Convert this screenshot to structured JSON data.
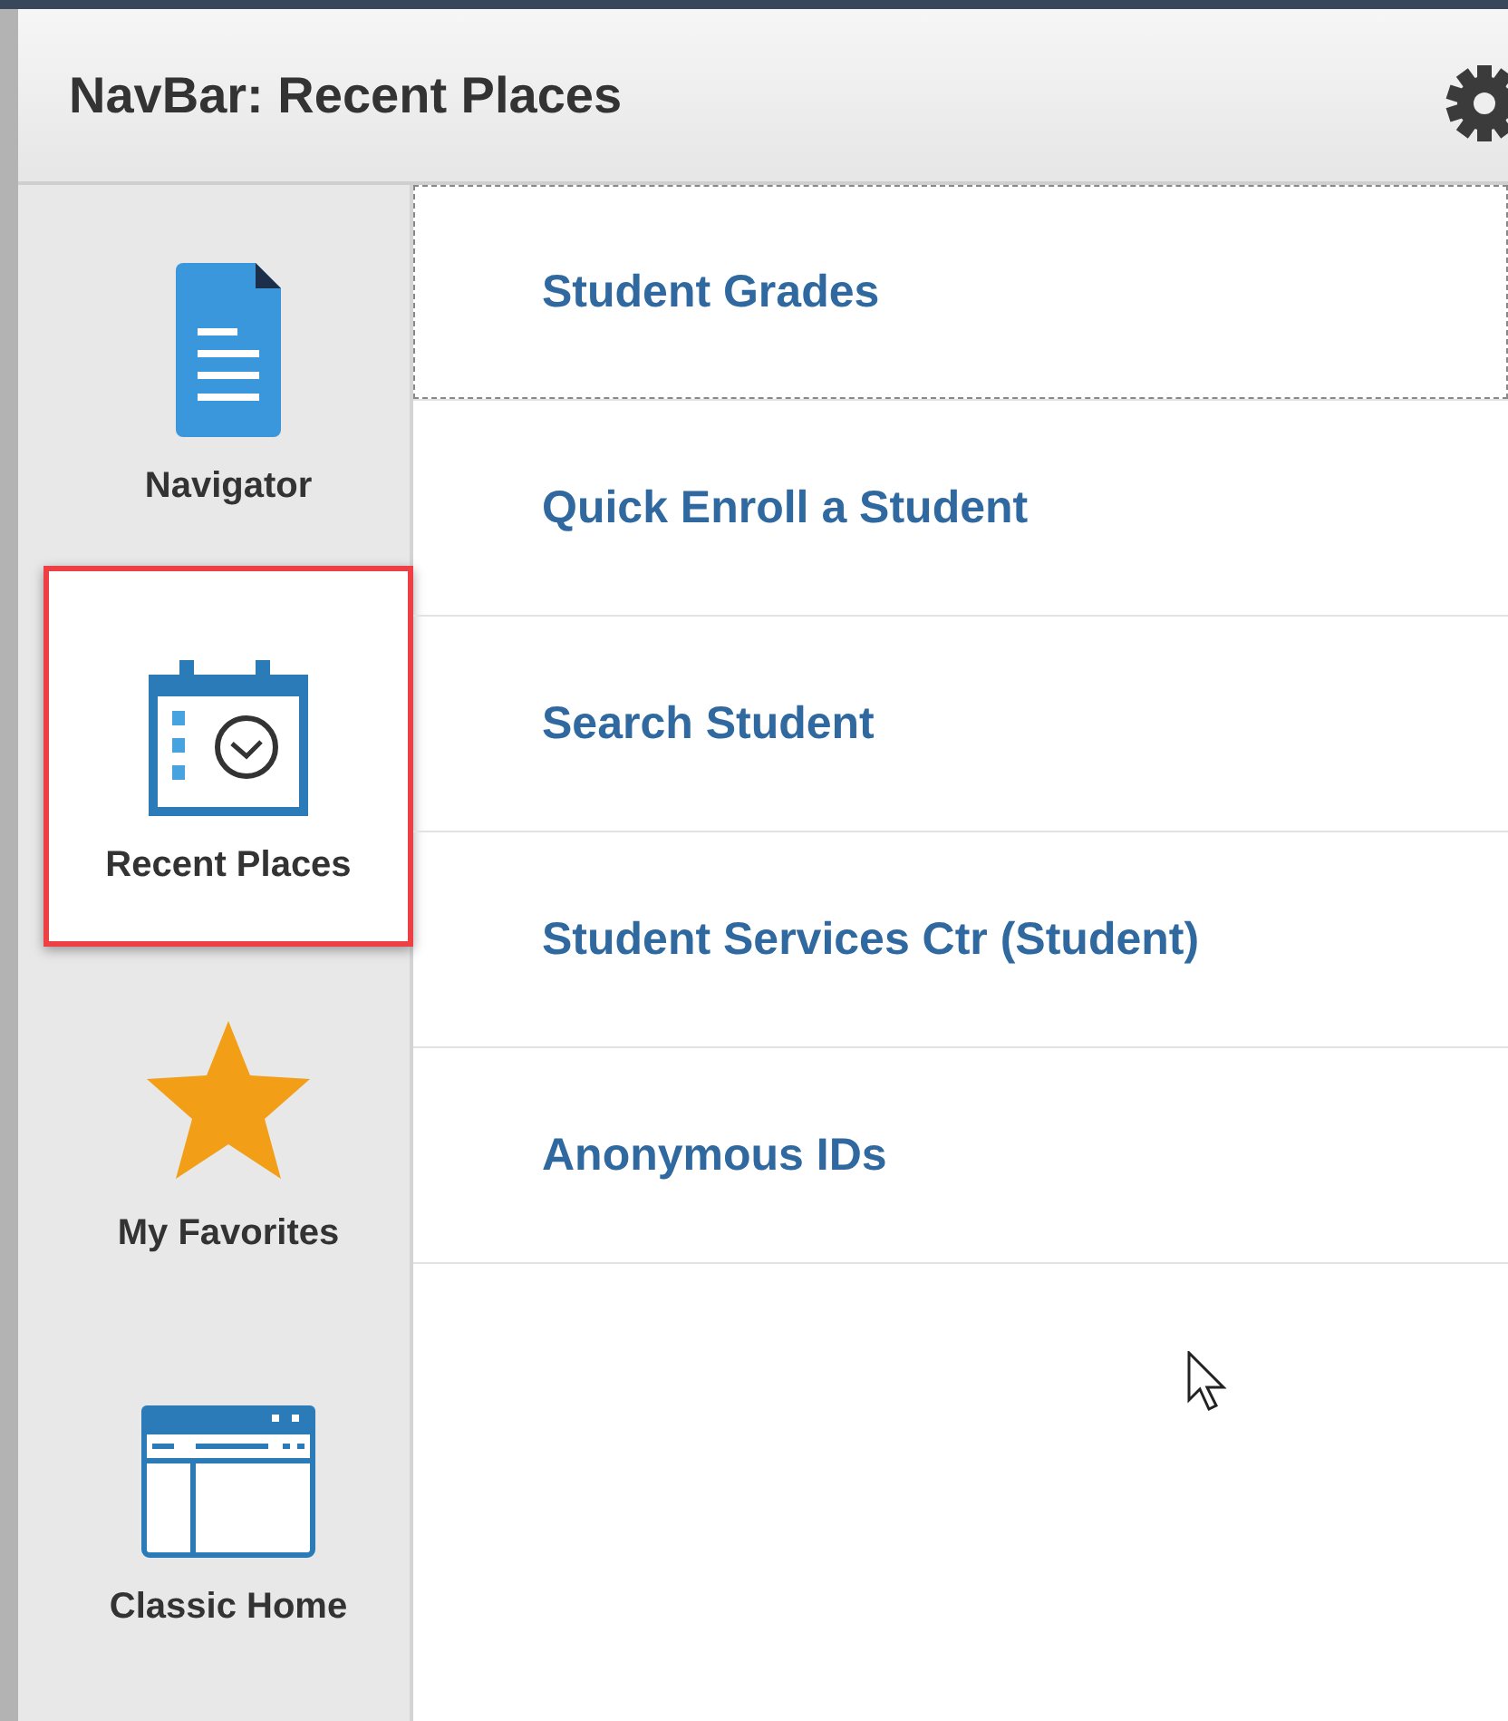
{
  "header": {
    "title": "NavBar: Recent Places"
  },
  "sidebar": {
    "items": [
      {
        "label": "Navigator",
        "kind": "document",
        "selected": false
      },
      {
        "label": "Recent Places",
        "kind": "calendar-clock",
        "selected": true
      },
      {
        "label": "My Favorites",
        "kind": "star",
        "selected": false
      },
      {
        "label": "Classic Home",
        "kind": "window",
        "selected": false
      }
    ]
  },
  "places": [
    {
      "label": "Student Grades",
      "focused": true
    },
    {
      "label": "Quick Enroll a Student",
      "focused": false
    },
    {
      "label": "Search Student",
      "focused": false
    },
    {
      "label": "Student Services Ctr (Student)",
      "focused": false
    },
    {
      "label": "Anonymous IDs",
      "focused": false
    }
  ]
}
